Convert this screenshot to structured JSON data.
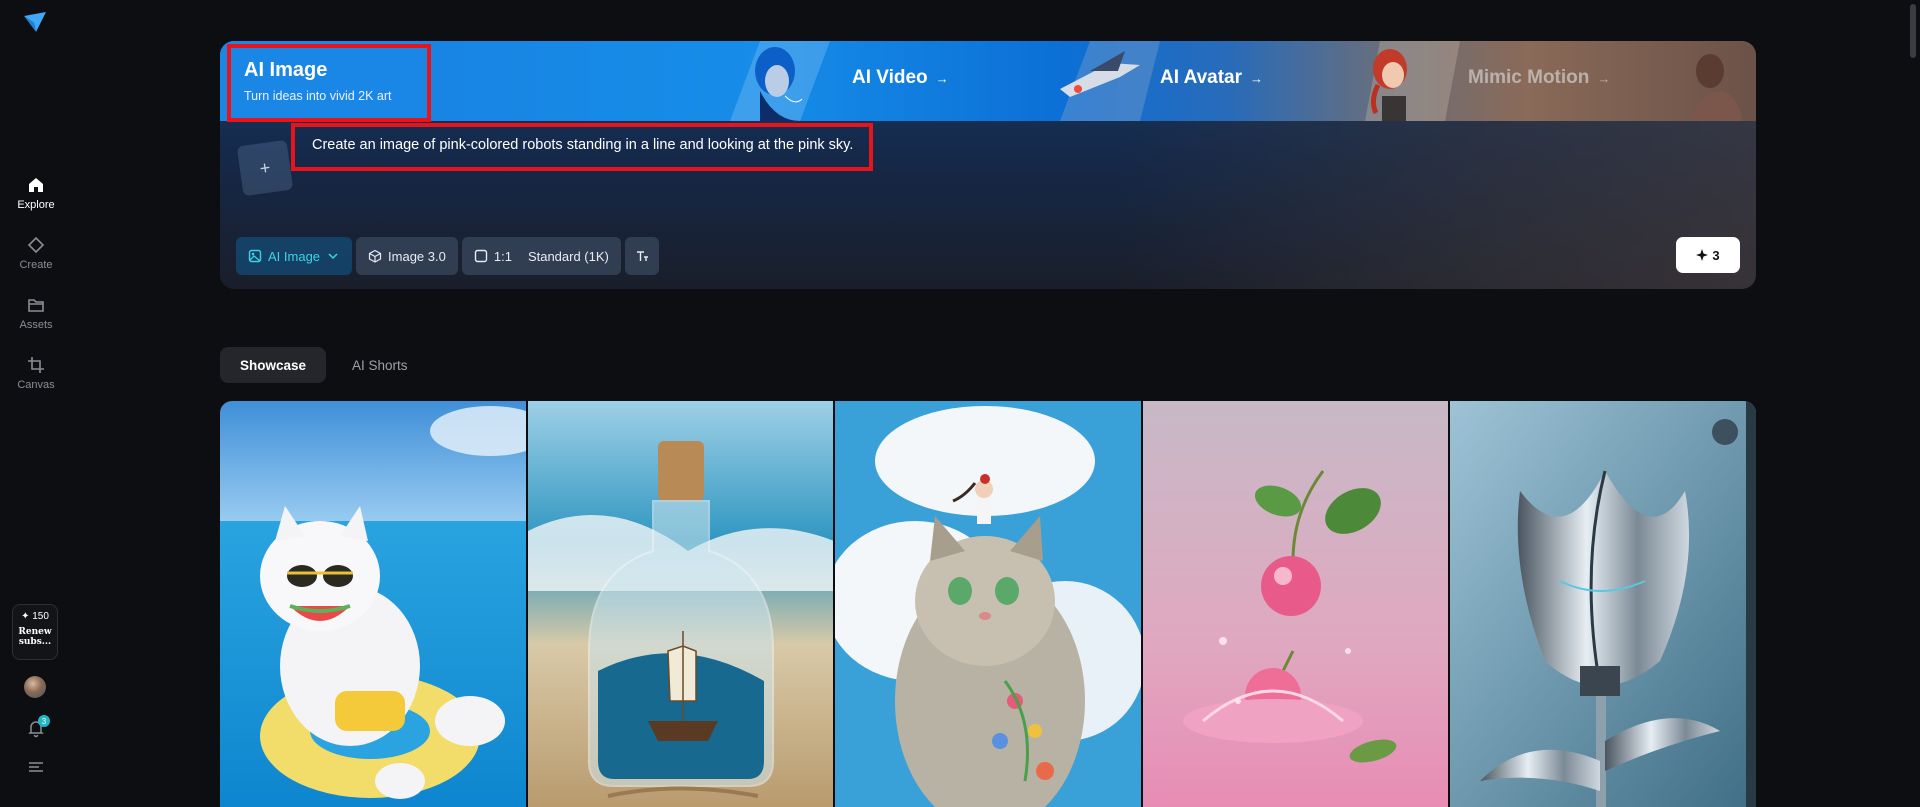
{
  "sidebar": {
    "items": [
      {
        "label": "Explore",
        "icon": "home-icon"
      },
      {
        "label": "Create",
        "icon": "diamond-icon"
      },
      {
        "label": "Assets",
        "icon": "folder-icon"
      },
      {
        "label": "Canvas",
        "icon": "crop-icon"
      }
    ],
    "credits": "✦ 150",
    "renew": "Renew subs...",
    "notification_count": "3"
  },
  "hero": {
    "active_tab": {
      "title": "AI Image",
      "subtitle": "Turn ideas into vivid 2K art"
    },
    "tabs": [
      {
        "label": "AI Video",
        "arrow": "→"
      },
      {
        "label": "AI Avatar",
        "arrow": "→"
      },
      {
        "label": "Mimic Motion",
        "arrow": "→"
      }
    ],
    "upload_symbol": "+",
    "prompt": "Create an image of pink-colored robots standing in a line and looking at the pink sky.",
    "toolbar": {
      "mode": "AI Image",
      "model": "Image 3.0",
      "ratio": "1:1",
      "quality": "Standard (1K)"
    },
    "generate_cost": "3"
  },
  "section_tabs": [
    "Showcase",
    "AI Shorts"
  ],
  "colors": {
    "accent": "#3fd2e6",
    "highlight_box": "#e8141a"
  }
}
